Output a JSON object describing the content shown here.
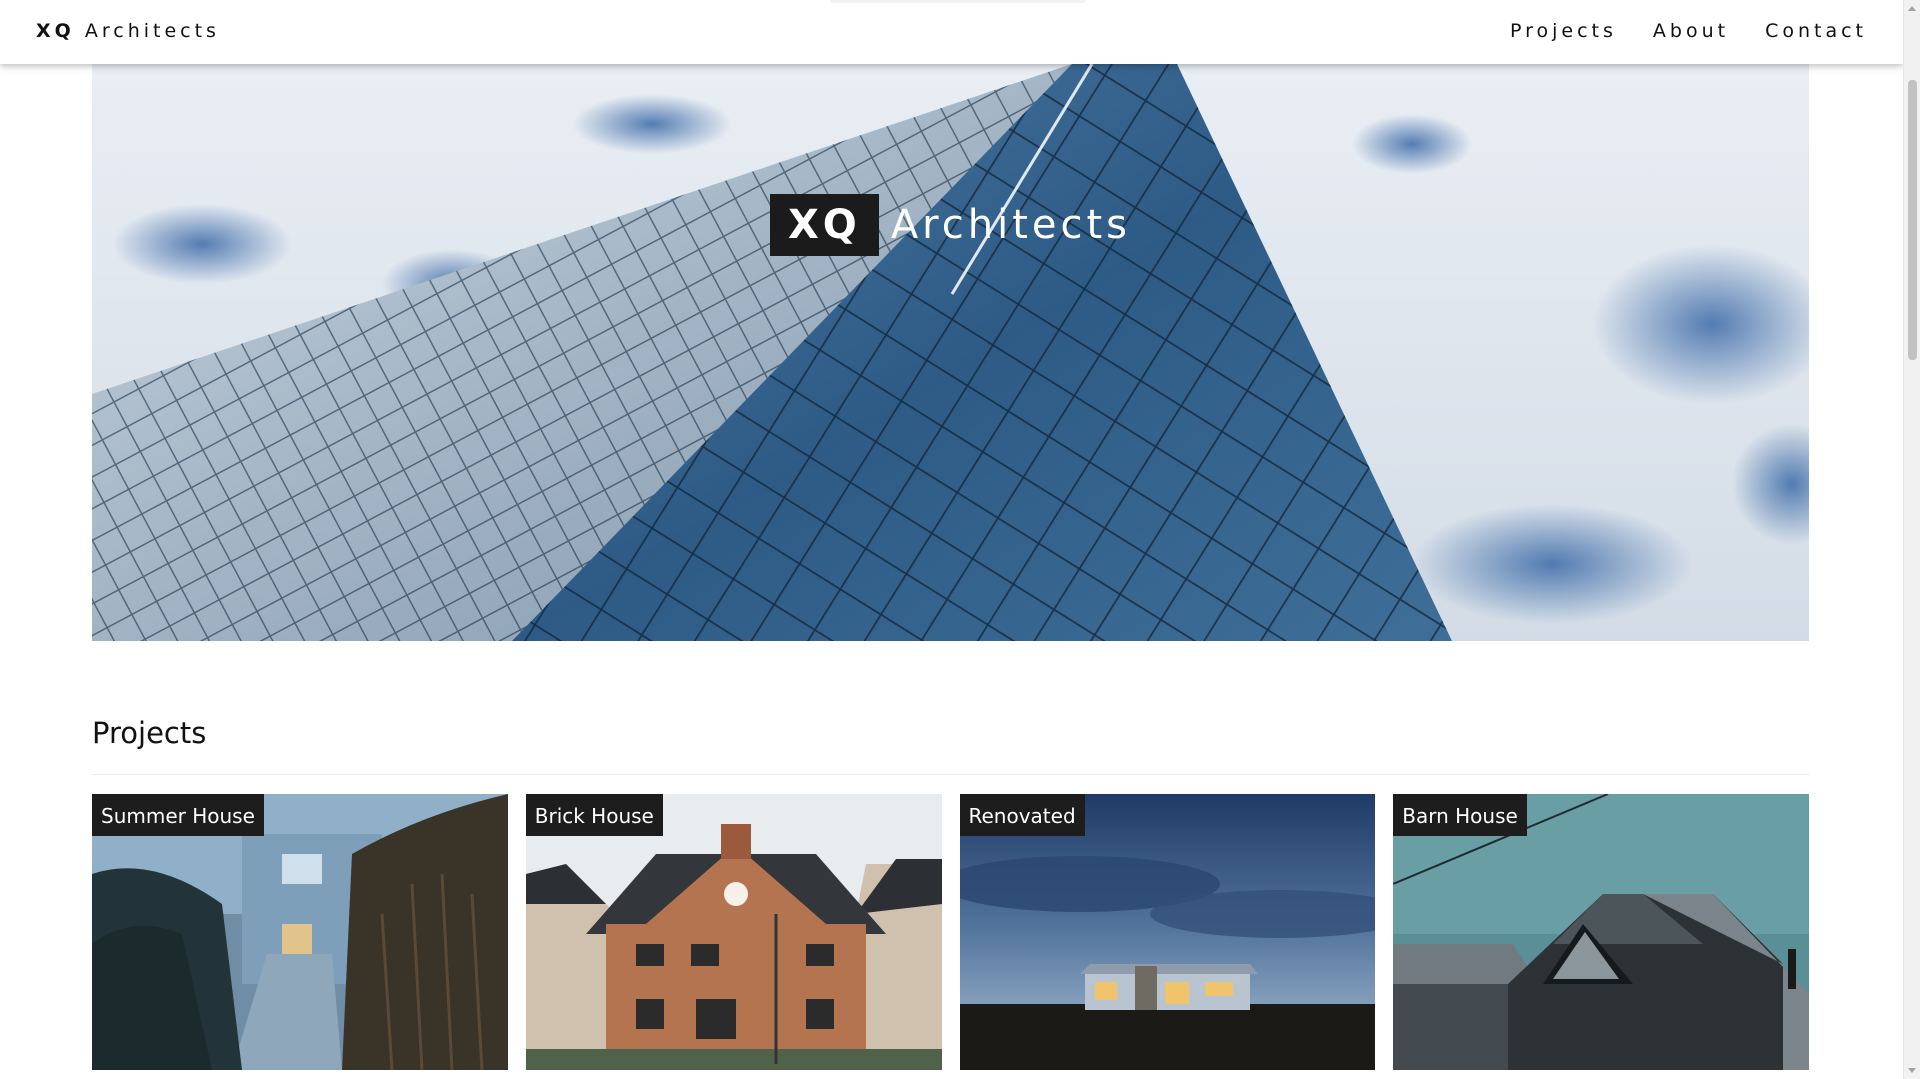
{
  "nav": {
    "brand_bold": "XQ",
    "brand_rest": "Architects",
    "links": [
      "Projects",
      "About",
      "Contact"
    ]
  },
  "hero": {
    "title_bold": "XQ",
    "title_rest": "Architects",
    "image": "glass-building-against-cloudy-sky"
  },
  "projects": {
    "heading": "Projects",
    "items": [
      {
        "label": "Summer House",
        "image": "blue-house-boardwalk-reeds"
      },
      {
        "label": "Brick House",
        "image": "red-brick-house"
      },
      {
        "label": "Renovated",
        "image": "lit-house-at-dusk"
      },
      {
        "label": "Barn House",
        "image": "dark-timber-barn-house"
      }
    ]
  },
  "colors": {
    "label_bg": "#1d1d1d",
    "nav_bg": "#ffffff",
    "sky": "#dfe6ee",
    "glass": "#2e5a86"
  }
}
